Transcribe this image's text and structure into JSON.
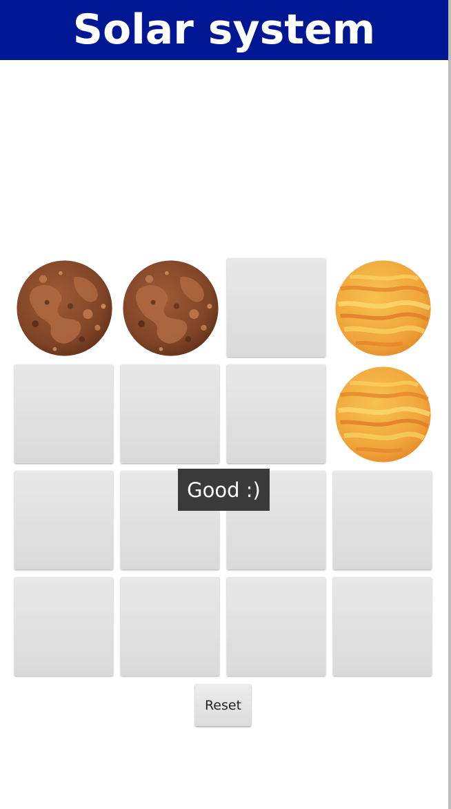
{
  "header": {
    "title": "Solar system",
    "background_color": "#001794",
    "text_color": "#ffffff"
  },
  "game": {
    "grid": {
      "rows": 4,
      "columns": 4
    },
    "cards": [
      {
        "row": 0,
        "col": 0,
        "state": "revealed",
        "planet": "mars-planet-icon"
      },
      {
        "row": 0,
        "col": 1,
        "state": "revealed",
        "planet": "mars-planet-icon"
      },
      {
        "row": 0,
        "col": 2,
        "state": "hidden"
      },
      {
        "row": 0,
        "col": 3,
        "state": "revealed",
        "planet": "venus-planet-icon"
      },
      {
        "row": 1,
        "col": 0,
        "state": "hidden"
      },
      {
        "row": 1,
        "col": 1,
        "state": "hidden"
      },
      {
        "row": 1,
        "col": 2,
        "state": "hidden"
      },
      {
        "row": 1,
        "col": 3,
        "state": "revealed",
        "planet": "venus-planet-icon"
      },
      {
        "row": 2,
        "col": 0,
        "state": "hidden"
      },
      {
        "row": 2,
        "col": 1,
        "state": "hidden"
      },
      {
        "row": 2,
        "col": 2,
        "state": "hidden"
      },
      {
        "row": 2,
        "col": 3,
        "state": "hidden"
      },
      {
        "row": 3,
        "col": 0,
        "state": "hidden"
      },
      {
        "row": 3,
        "col": 1,
        "state": "hidden"
      },
      {
        "row": 3,
        "col": 2,
        "state": "hidden"
      },
      {
        "row": 3,
        "col": 3,
        "state": "hidden"
      }
    ],
    "toast_message": "Good :)",
    "reset_label": "Reset"
  },
  "colors": {
    "card_back": "#dedede",
    "toast_background": "#3a3a3a",
    "mars_base": "#8a4a2a",
    "venus_base": "#f0a53a"
  }
}
